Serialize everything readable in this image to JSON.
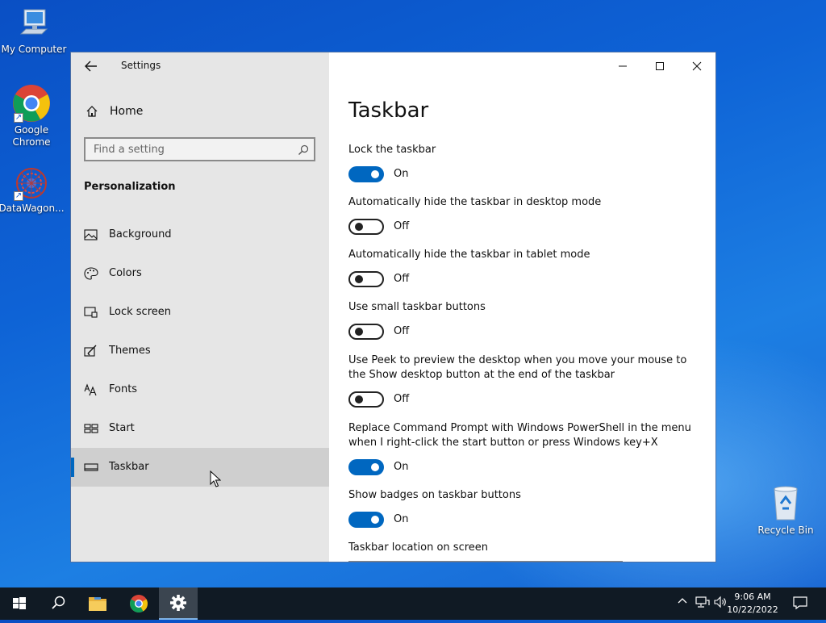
{
  "desktop": {
    "icons": [
      {
        "label": "My Computer"
      },
      {
        "label": "Google Chrome"
      },
      {
        "label": "DataWagon..."
      },
      {
        "label": "Recycle Bin"
      }
    ]
  },
  "window": {
    "title": "Settings",
    "sidebar": {
      "home_label": "Home",
      "search_placeholder": "Find a setting",
      "section_title": "Personalization",
      "items": [
        {
          "label": "Background",
          "icon": "picture-icon"
        },
        {
          "label": "Colors",
          "icon": "palette-icon"
        },
        {
          "label": "Lock screen",
          "icon": "monitor-icon"
        },
        {
          "label": "Themes",
          "icon": "brush-icon"
        },
        {
          "label": "Fonts",
          "icon": "font-icon"
        },
        {
          "label": "Start",
          "icon": "start-tiles-icon"
        },
        {
          "label": "Taskbar",
          "icon": "taskbar-icon",
          "selected": true
        }
      ]
    },
    "content": {
      "page_title": "Taskbar",
      "settings": [
        {
          "label": "Lock the taskbar",
          "state": "On"
        },
        {
          "label": "Automatically hide the taskbar in desktop mode",
          "state": "Off"
        },
        {
          "label": "Automatically hide the taskbar in tablet mode",
          "state": "Off"
        },
        {
          "label": "Use small taskbar buttons",
          "state": "Off"
        },
        {
          "label": "Use Peek to preview the desktop when you move your mouse to the Show desktop button at the end of the taskbar",
          "state": "Off"
        },
        {
          "label": "Replace Command Prompt with Windows PowerShell in the menu when I right-click the start button or press Windows key+X",
          "state": "On"
        },
        {
          "label": "Show badges on taskbar buttons",
          "state": "On"
        }
      ],
      "location_label": "Taskbar location on screen"
    }
  },
  "taskbar": {
    "time": "9:06 AM",
    "date": "10/22/2022"
  },
  "colors": {
    "accent": "#0067c0",
    "sidebar_bg": "#e6e6e6",
    "taskbar_bg": "#101a24"
  }
}
